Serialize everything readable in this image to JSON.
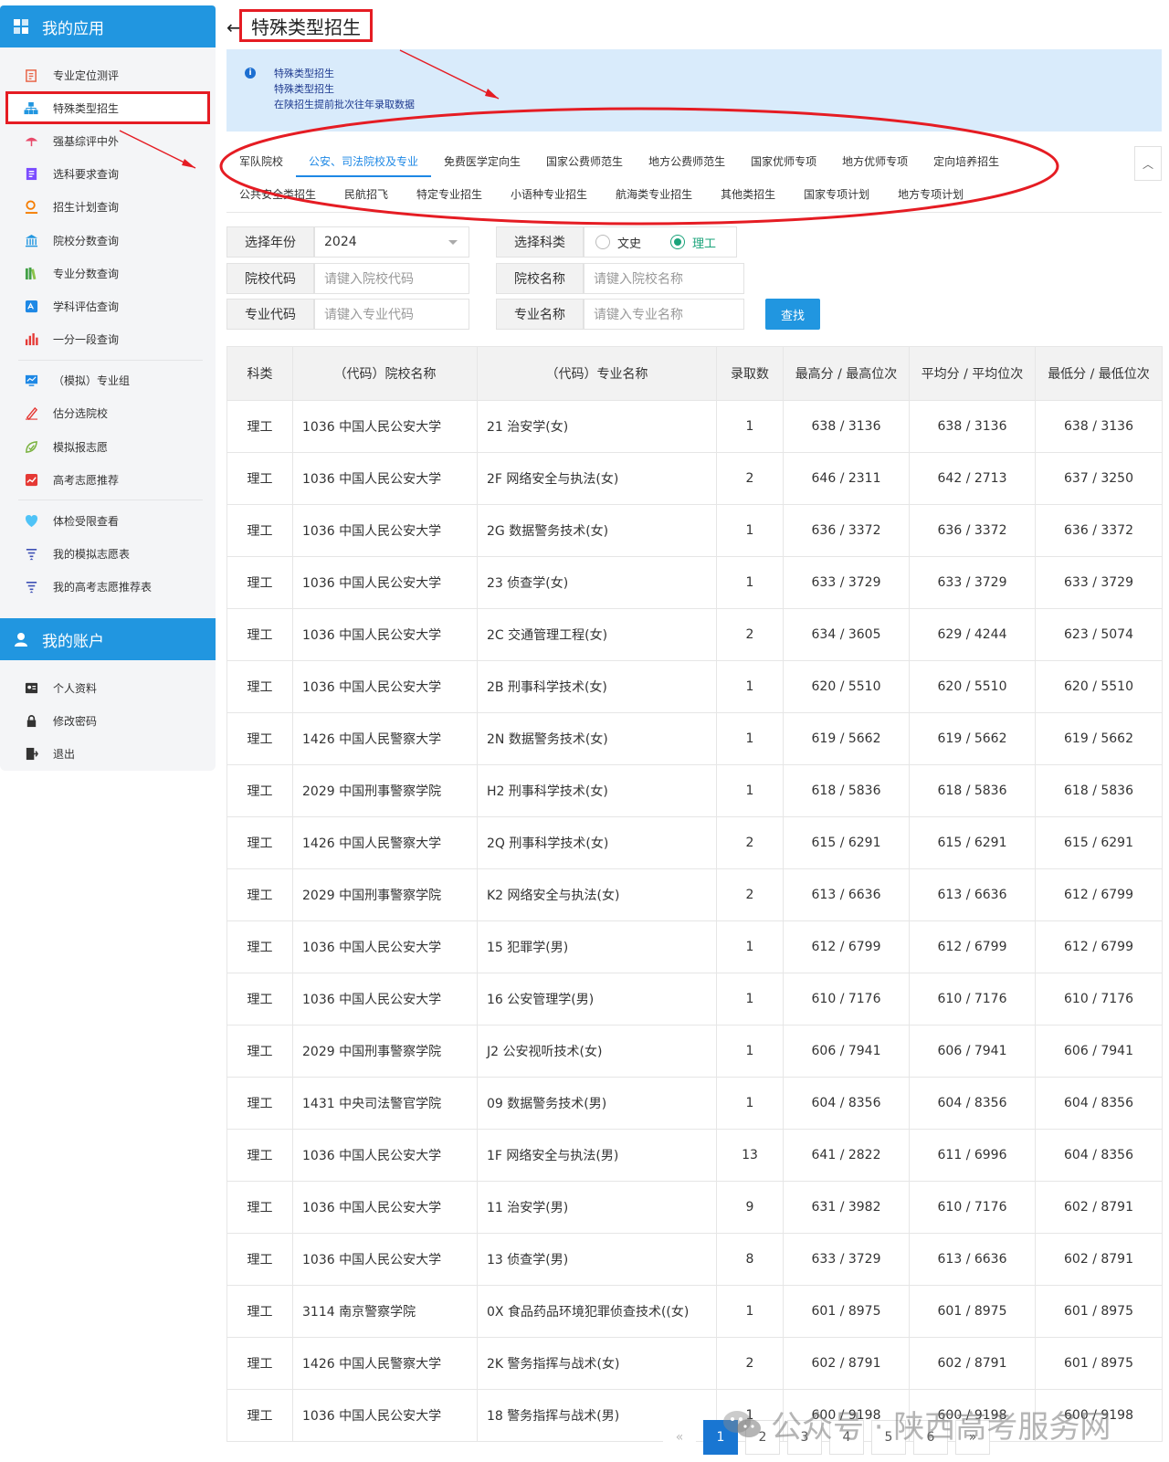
{
  "sidebar": {
    "my_apps_title": "我的应用",
    "items": [
      {
        "label": "专业定位测评",
        "icon": "clipboard-icon",
        "color": "#e8664a"
      },
      {
        "label": "特殊类型招生",
        "icon": "org-chart-icon",
        "color": "#2196e0"
      },
      {
        "label": "强基综评中外",
        "icon": "umbrella-icon",
        "color": "#e84a6a"
      },
      {
        "label": "选科要求查询",
        "icon": "checklist-icon",
        "color": "#7c4dff"
      },
      {
        "label": "招生计划查询",
        "icon": "user-search-icon",
        "color": "#f57c00"
      },
      {
        "label": "院校分数查询",
        "icon": "bank-icon",
        "color": "#2196e0"
      },
      {
        "label": "专业分数查询",
        "icon": "books-icon",
        "color": "#43a047"
      },
      {
        "label": "学科评估查询",
        "icon": "rating-icon",
        "color": "#1e88e5"
      },
      {
        "label": "一分一段查询",
        "icon": "bar-chart-icon",
        "color": "#e53935"
      },
      {
        "label": "（模拟）专业组",
        "icon": "monitor-chart-icon",
        "color": "#1e88e5"
      },
      {
        "label": "估分选院校",
        "icon": "pencil-icon",
        "color": "#e53935"
      },
      {
        "label": "模拟报志愿",
        "icon": "leaf-check-icon",
        "color": "#7cb342"
      },
      {
        "label": "高考志愿推荐",
        "icon": "trend-chart-icon",
        "color": "#e53935"
      },
      {
        "label": "体检受限查看",
        "icon": "heart-shield-icon",
        "color": "#4fc3f7"
      },
      {
        "label": "我的模拟志愿表",
        "icon": "sort-list-icon",
        "color": "#3f51b5"
      },
      {
        "label": "我的高考志愿推荐表",
        "icon": "sort-list-icon",
        "color": "#3f51b5"
      }
    ],
    "account_title": "我的账户",
    "account_items": [
      {
        "label": "个人资料",
        "icon": "id-card-icon"
      },
      {
        "label": "修改密码",
        "icon": "lock-icon"
      },
      {
        "label": "退出",
        "icon": "logout-icon"
      }
    ]
  },
  "header": {
    "back": "←",
    "title": "特殊类型招生"
  },
  "info": {
    "line1": "特殊类型招生",
    "line2": "特殊类型招生",
    "line3": "在陕招生提前批次往年录取数据"
  },
  "tabs": {
    "row1": [
      "军队院校",
      "公安、司法院校及专业",
      "免费医学定向生",
      "国家公费师范生",
      "地方公费师范生",
      "国家优师专项",
      "地方优师专项",
      "定向培养招生"
    ],
    "row2": [
      "公共安全类招生",
      "民航招飞",
      "特定专业招生",
      "小语种专业招生",
      "航海类专业招生",
      "其他类招生",
      "国家专项计划",
      "地方专项计划"
    ],
    "active": "公安、司法院校及专业",
    "collapse": "︿"
  },
  "filters": {
    "year_label": "选择年份",
    "year_value": "2024",
    "subject_label": "选择科类",
    "subject_options": [
      "文史",
      "理工"
    ],
    "subject_selected": "理工",
    "school_code_label": "院校代码",
    "school_code_placeholder": "请键入院校代码",
    "school_name_label": "院校名称",
    "school_name_placeholder": "请键入院校名称",
    "major_code_label": "专业代码",
    "major_code_placeholder": "请键入专业代码",
    "major_name_label": "专业名称",
    "major_name_placeholder": "请键入专业名称",
    "search_button": "查找"
  },
  "table": {
    "headers": [
      "科类",
      "（代码）院校名称",
      "（代码）专业名称",
      "录取数",
      "最高分 / 最高位次",
      "平均分 / 平均位次",
      "最低分 / 最低位次"
    ],
    "rows": [
      [
        "理工",
        "1036 中国人民公安大学",
        "21 治安学(女)",
        "1",
        "638 / 3136",
        "638 / 3136",
        "638 / 3136"
      ],
      [
        "理工",
        "1036 中国人民公安大学",
        "2F 网络安全与执法(女)",
        "2",
        "646 / 2311",
        "642 / 2713",
        "637 / 3250"
      ],
      [
        "理工",
        "1036 中国人民公安大学",
        "2G 数据警务技术(女)",
        "1",
        "636 / 3372",
        "636 / 3372",
        "636 / 3372"
      ],
      [
        "理工",
        "1036 中国人民公安大学",
        "23 侦查学(女)",
        "1",
        "633 / 3729",
        "633 / 3729",
        "633 / 3729"
      ],
      [
        "理工",
        "1036 中国人民公安大学",
        "2C 交通管理工程(女)",
        "2",
        "634 / 3605",
        "629 / 4244",
        "623 / 5074"
      ],
      [
        "理工",
        "1036 中国人民公安大学",
        "2B 刑事科学技术(女)",
        "1",
        "620 / 5510",
        "620 / 5510",
        "620 / 5510"
      ],
      [
        "理工",
        "1426 中国人民警察大学",
        "2N 数据警务技术(女)",
        "1",
        "619 / 5662",
        "619 / 5662",
        "619 / 5662"
      ],
      [
        "理工",
        "2029 中国刑事警察学院",
        "H2 刑事科学技术(女)",
        "1",
        "618 / 5836",
        "618 / 5836",
        "618 / 5836"
      ],
      [
        "理工",
        "1426 中国人民警察大学",
        "2Q 刑事科学技术(女)",
        "2",
        "615 / 6291",
        "615 / 6291",
        "615 / 6291"
      ],
      [
        "理工",
        "2029 中国刑事警察学院",
        "K2 网络安全与执法(女)",
        "2",
        "613 / 6636",
        "613 / 6636",
        "612 / 6799"
      ],
      [
        "理工",
        "1036 中国人民公安大学",
        "15 犯罪学(男)",
        "1",
        "612 / 6799",
        "612 / 6799",
        "612 / 6799"
      ],
      [
        "理工",
        "1036 中国人民公安大学",
        "16 公安管理学(男)",
        "1",
        "610 / 7176",
        "610 / 7176",
        "610 / 7176"
      ],
      [
        "理工",
        "2029 中国刑事警察学院",
        "J2 公安视听技术(女)",
        "1",
        "606 / 7941",
        "606 / 7941",
        "606 / 7941"
      ],
      [
        "理工",
        "1431 中央司法警官学院",
        "09 数据警务技术(男)",
        "1",
        "604 / 8356",
        "604 / 8356",
        "604 / 8356"
      ],
      [
        "理工",
        "1036 中国人民公安大学",
        "1F 网络安全与执法(男)",
        "13",
        "641 / 2822",
        "611 / 6996",
        "604 / 8356"
      ],
      [
        "理工",
        "1036 中国人民公安大学",
        "11 治安学(男)",
        "9",
        "631 / 3982",
        "610 / 7176",
        "602 / 8791"
      ],
      [
        "理工",
        "1036 中国人民公安大学",
        "13 侦查学(男)",
        "8",
        "633 / 3729",
        "613 / 6636",
        "602 / 8791"
      ],
      [
        "理工",
        "3114 南京警察学院",
        "0X 食品药品环境犯罪侦查技术((女)",
        "1",
        "601 / 8975",
        "601 / 8975",
        "601 / 8975"
      ],
      [
        "理工",
        "1426 中国人民警察大学",
        "2K 警务指挥与战术(女)",
        "2",
        "602 / 8791",
        "602 / 8791",
        "601 / 8975"
      ],
      [
        "理工",
        "1036 中国人民公安大学",
        "18 警务指挥与战术(男)",
        "1",
        "600 / 9198",
        "600 / 9198",
        "600 / 9198"
      ]
    ]
  },
  "pagination": {
    "prev": "«",
    "pages": [
      "1",
      "2",
      "3",
      "4",
      "5",
      "6"
    ],
    "active": "1",
    "next": "»"
  },
  "watermark": {
    "text": "公众号 · 陕西高考服务网"
  },
  "colors": {
    "primary": "#2196e0",
    "annotation_red": "#e51c23",
    "info_bg": "#d9ebfb",
    "radio_green": "#1aa37a"
  }
}
